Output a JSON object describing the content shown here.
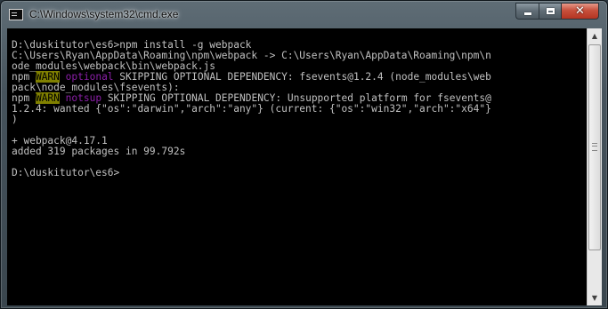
{
  "window": {
    "title": "C:\\Windows\\system32\\cmd.exe",
    "icon": "console-icon",
    "controls": {
      "minimize": "minimize-icon",
      "maximize": "maximize-icon",
      "close": "close-icon"
    }
  },
  "console": {
    "colors": {
      "background": "#000000",
      "text": "#c0c0c0",
      "warn_bg": "#808000",
      "warn_text": "#000000",
      "tag_text": "#8b1fa8"
    },
    "lines": [
      {
        "parts": [
          {
            "text": "D:\\duskitutor\\es6>npm install -g webpack"
          }
        ]
      },
      {
        "parts": [
          {
            "text": "C:\\Users\\Ryan\\AppData\\Roaming\\npm\\webpack -> C:\\Users\\Ryan\\AppData\\Roaming\\npm\\n"
          }
        ]
      },
      {
        "parts": [
          {
            "text": "ode_modules\\webpack\\bin\\webpack.js"
          }
        ]
      },
      {
        "parts": [
          {
            "text": "npm "
          },
          {
            "text": "WARN",
            "style": "warn"
          },
          {
            "text": " "
          },
          {
            "text": "optional",
            "style": "tag"
          },
          {
            "text": " SKIPPING OPTIONAL DEPENDENCY: fsevents@1.2.4 (node_modules\\web"
          }
        ]
      },
      {
        "parts": [
          {
            "text": "pack\\node_modules\\fsevents):"
          }
        ]
      },
      {
        "parts": [
          {
            "text": "npm "
          },
          {
            "text": "WARN",
            "style": "warn"
          },
          {
            "text": " "
          },
          {
            "text": "notsup",
            "style": "tag"
          },
          {
            "text": " SKIPPING OPTIONAL DEPENDENCY: Unsupported platform for fsevents@"
          }
        ]
      },
      {
        "parts": [
          {
            "text": "1.2.4: wanted {\"os\":\"darwin\",\"arch\":\"any\"} (current: {\"os\":\"win32\",\"arch\":\"x64\"}"
          }
        ]
      },
      {
        "parts": [
          {
            "text": ")"
          }
        ]
      },
      {
        "parts": []
      },
      {
        "parts": [
          {
            "text": "+ webpack@4.17.1"
          }
        ]
      },
      {
        "parts": [
          {
            "text": "added 319 packages in 99.792s"
          }
        ]
      },
      {
        "parts": []
      },
      {
        "parts": [
          {
            "text": "D:\\duskitutor\\es6>"
          }
        ]
      }
    ]
  },
  "scrollbar": {
    "up_icon": "scroll-up-arrow-icon",
    "down_icon": "scroll-down-arrow-icon",
    "up_glyph": "▲",
    "down_glyph": "▼"
  }
}
